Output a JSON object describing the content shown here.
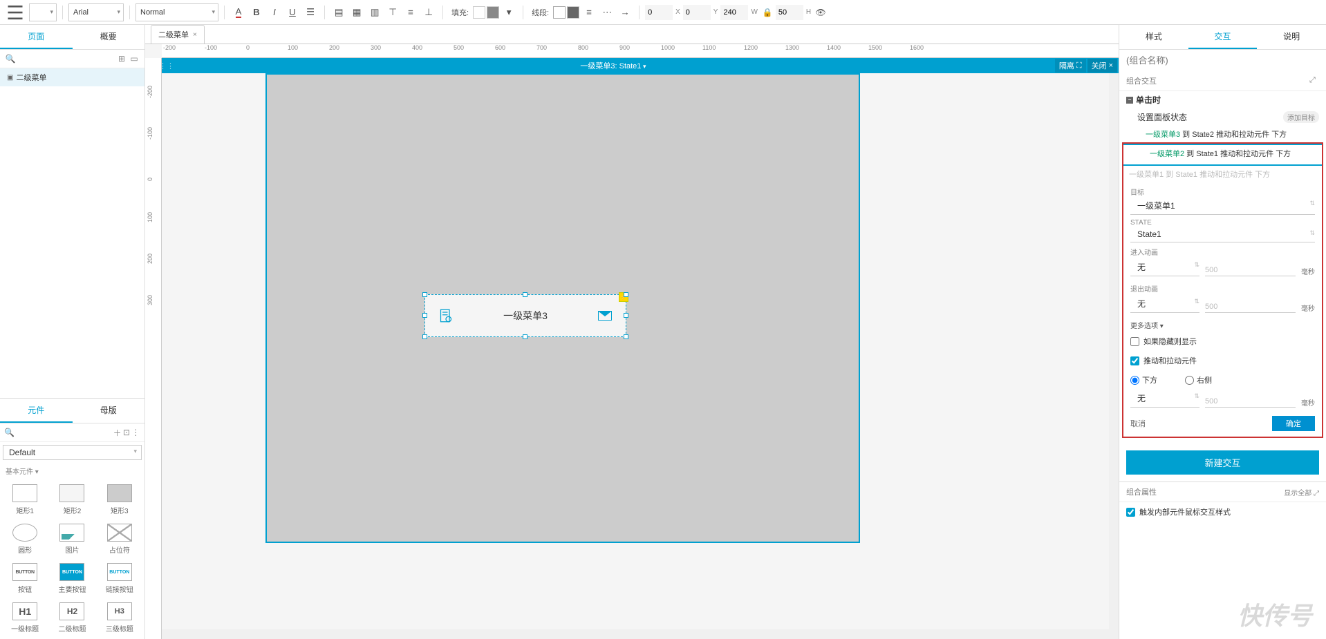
{
  "toolbar": {
    "font": "Arial",
    "font_size": "Normal",
    "fill_label": "填充:",
    "stroke_label": "线段:",
    "x_label": "X",
    "y_label": "Y",
    "w_label": "W",
    "h_label": "H",
    "x": "0",
    "y": "0",
    "w": "240",
    "h": "50"
  },
  "left": {
    "tab_page": "页面",
    "tab_outline": "概要",
    "tree_item": "二级菜单",
    "tab_widgets": "元件",
    "tab_masters": "母版",
    "library": "Default",
    "category": "基本元件 ▾",
    "widgets": [
      {
        "name": "矩形1",
        "cls": ""
      },
      {
        "name": "矩形2",
        "cls": "g1"
      },
      {
        "name": "矩形3",
        "cls": "g2"
      },
      {
        "name": "圆形",
        "cls": "circ"
      },
      {
        "name": "图片",
        "cls": "img"
      },
      {
        "name": "占位符",
        "cls": "ph"
      },
      {
        "name": "按钮",
        "cls": "btn",
        "txt": "BUTTON"
      },
      {
        "name": "主要按钮",
        "cls": "pbtn",
        "txt": "BUTTON"
      },
      {
        "name": "链接按钮",
        "cls": "lbtn",
        "txt": "BUTTON"
      },
      {
        "name": "一级标题",
        "cls": "h1",
        "txt": "H1"
      },
      {
        "name": "二级标题",
        "cls": "h2",
        "txt": "H2"
      },
      {
        "name": "三级标题",
        "cls": "h3",
        "txt": "H3"
      }
    ]
  },
  "canvas": {
    "tab": "二级菜单",
    "state_title": "一级菜单3: State1",
    "isolate": "隔离",
    "close": "关闭",
    "shape_text": "一级菜单3",
    "ruler_h": [
      "-200",
      "-100",
      "0",
      "100",
      "200",
      "300",
      "400",
      "500",
      "600",
      "700",
      "800",
      "900",
      "1000",
      "1100",
      "1200",
      "1300",
      "1400",
      "1500",
      "1600"
    ],
    "ruler_v": [
      "-200",
      "-100",
      "0",
      "100",
      "200",
      "300"
    ]
  },
  "right": {
    "tab_style": "样式",
    "tab_inter": "交互",
    "tab_note": "说明",
    "group_name_ph": "(组合名称)",
    "group_inter": "组合交互",
    "event": "单击时",
    "action": "设置面板状态",
    "add_target": "添加目标",
    "line1_a": "一级菜单3",
    "line1_b": " 到 State2 推动和拉动元件 下方",
    "line2_a": "一级菜单2",
    "line2_b": " 到 State1 推动和拉动元件 下方",
    "desc": "一级菜单1 到 State1 推动和拉动元件 下方",
    "lbl_target": "目标",
    "val_target": "一级菜单1",
    "lbl_state": "STATE",
    "val_state": "State1",
    "lbl_in": "进入动画",
    "val_in": "无",
    "in_ms": "500",
    "lbl_out": "退出动画",
    "val_out": "无",
    "out_ms": "500",
    "more": "更多选项 ▾",
    "chk_show": "如果隐藏则显示",
    "chk_push": "推动和拉动元件",
    "rad_below": "下方",
    "rad_right": "右侧",
    "push_anim": "无",
    "push_ms": "500",
    "ms_unit": "毫秒",
    "cancel": "取消",
    "ok": "确定",
    "new_inter": "新建交互",
    "group_props": "组合属性",
    "show_all": "显示全部",
    "chk_trigger": "触发内部元件鼠标交互样式"
  },
  "watermark": "快传号"
}
